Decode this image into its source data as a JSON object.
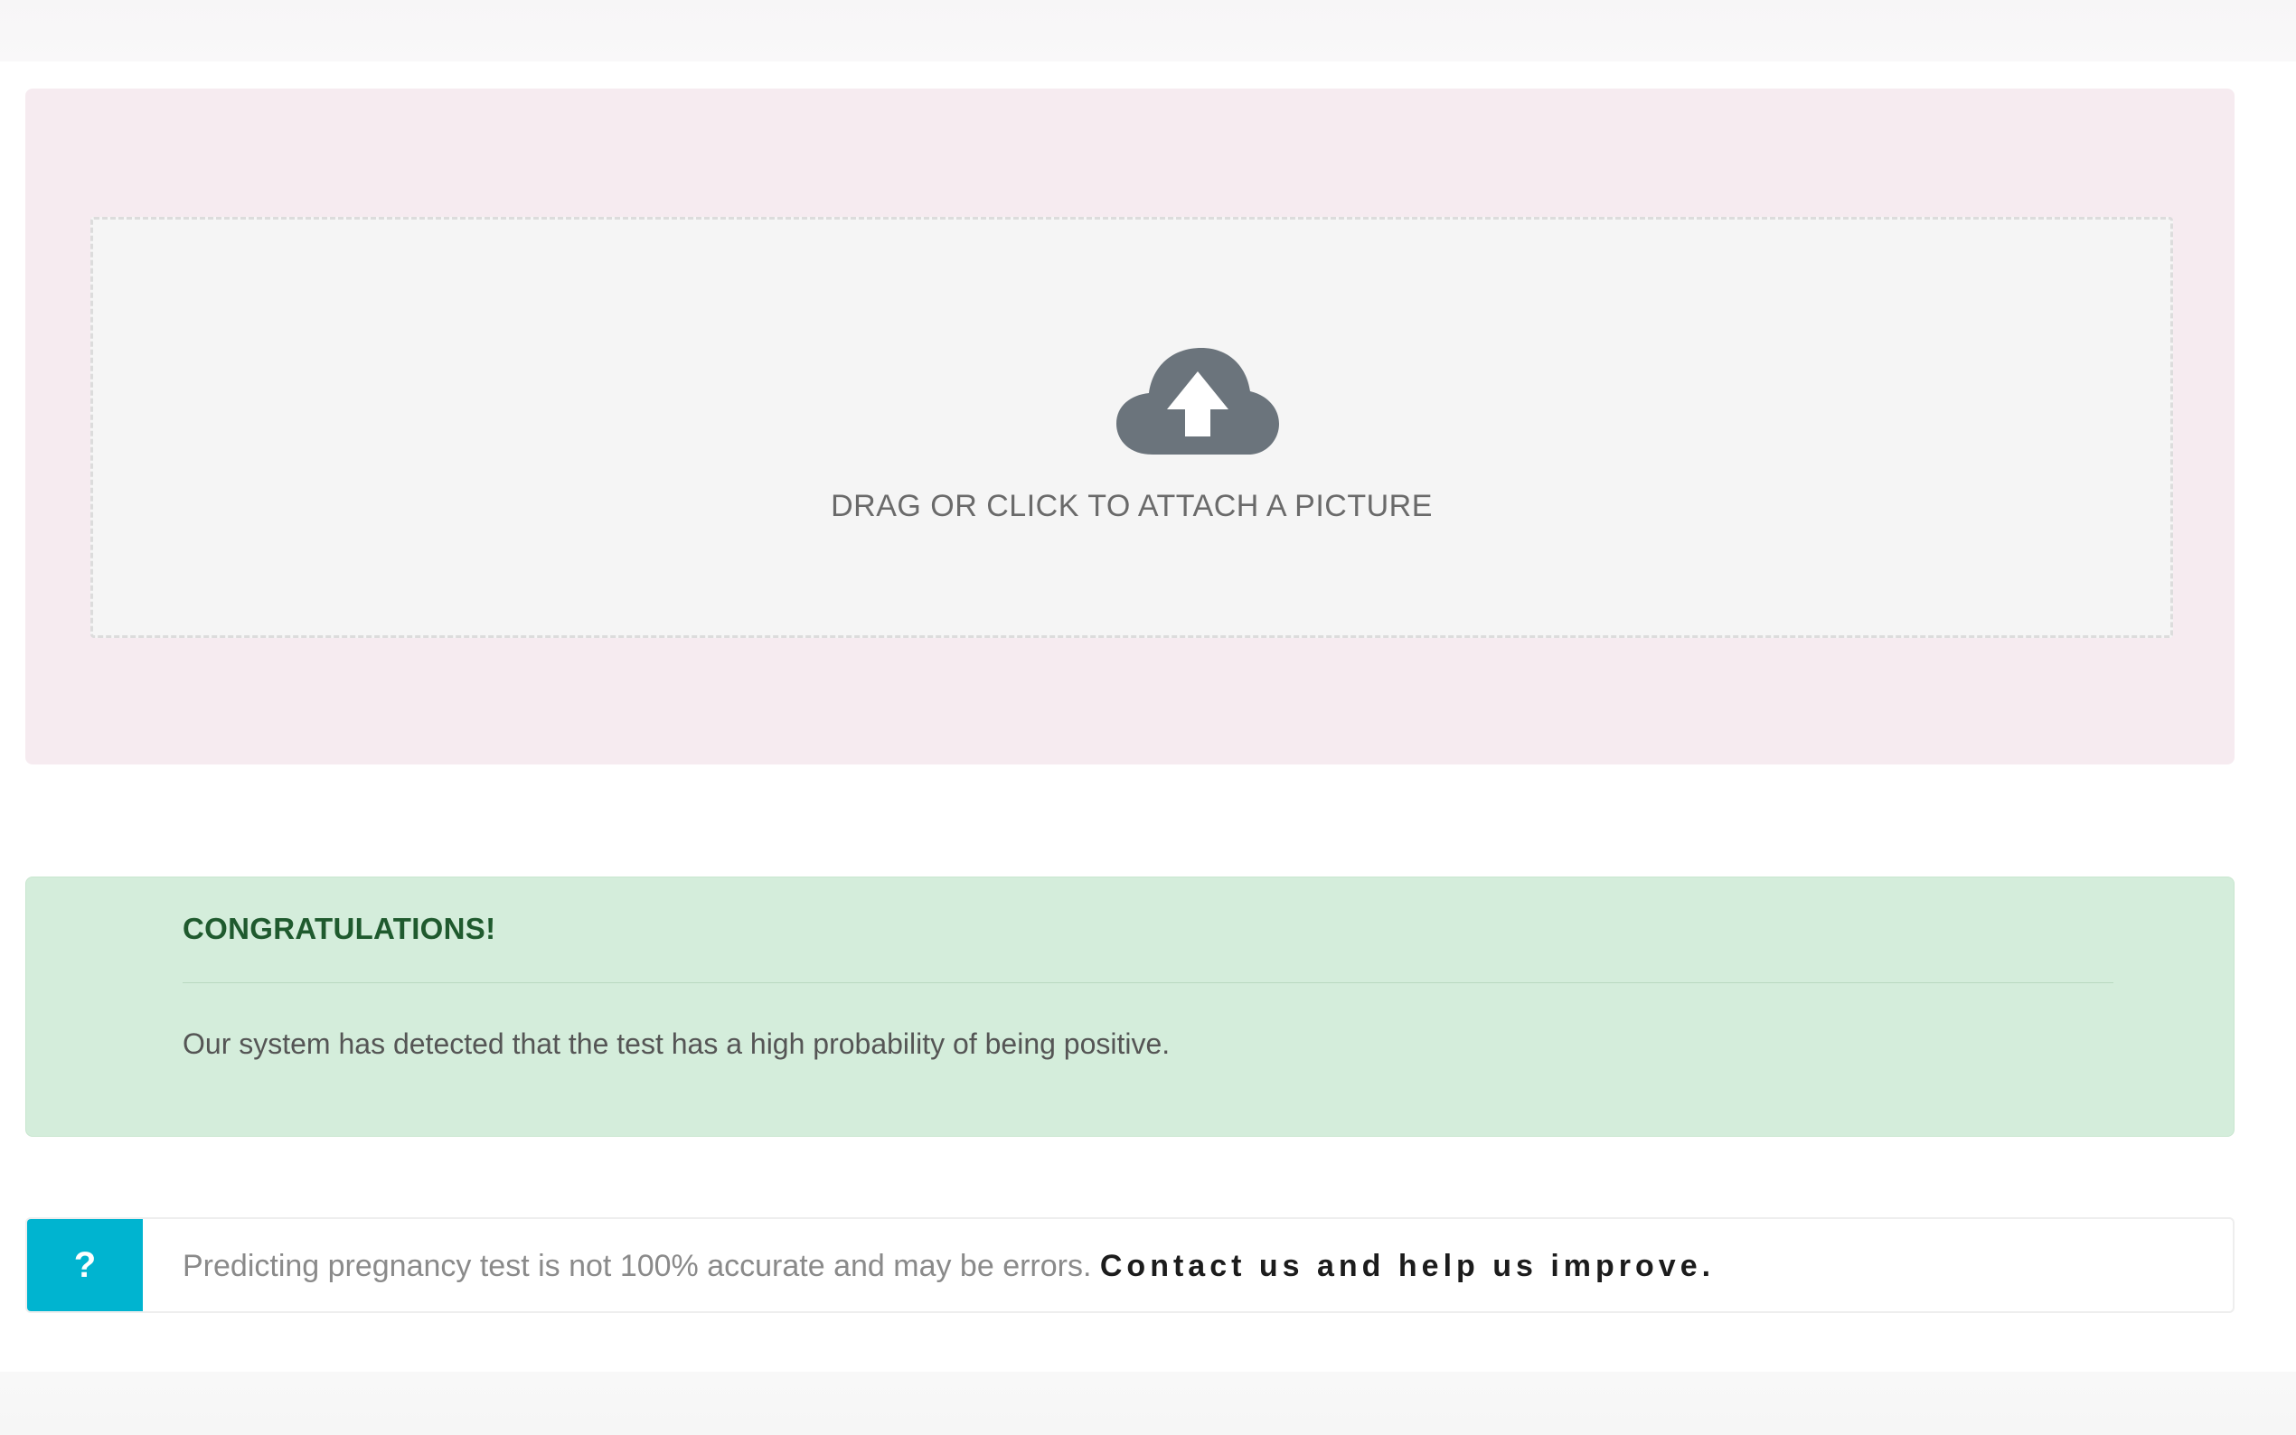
{
  "upload": {
    "icon": "cloud-upload-icon",
    "instruction": "DRAG OR CLICK TO ATTACH A PICTURE"
  },
  "result": {
    "title": "CONGRATULATIONS!",
    "message": "Our system has detected that the test has a high probability of being positive."
  },
  "info": {
    "badge": "?",
    "disclaimer": "Predicting pregnancy test is not 100% accurate and may be errors. ",
    "link": "Contact us and help us improve."
  },
  "colors": {
    "upload_panel_bg": "#f6ebf0",
    "dropzone_bg": "#f5f5f5",
    "icon": "#6b747c",
    "success_bg": "#d4eddb",
    "success_title": "#1f5a2e",
    "help_badge": "#00b4d0"
  }
}
